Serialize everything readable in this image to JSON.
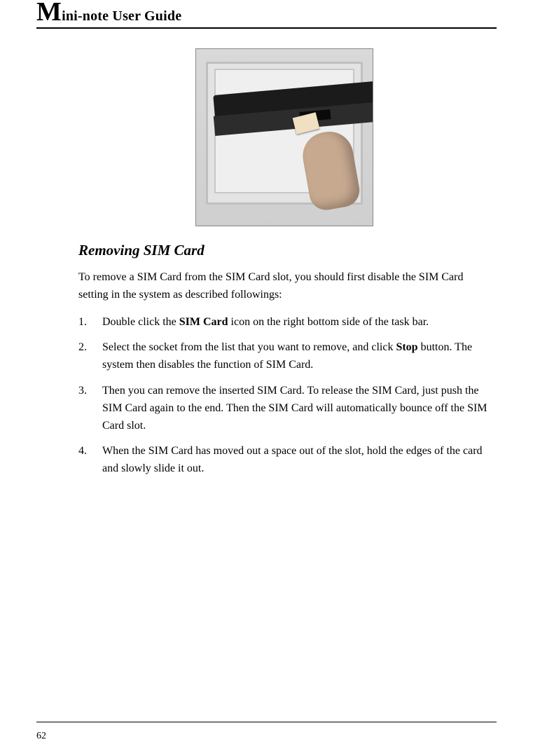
{
  "header": {
    "big_letter": "M",
    "rest": "ini-note User Guide"
  },
  "section": {
    "heading": "Removing SIM Card",
    "intro": "To remove a SIM Card from the SIM Card slot, you should first disable the SIM Card setting in the system as described followings:",
    "steps": [
      {
        "pre": "Double click the ",
        "bold": "SIM Card",
        "post": " icon on the right bottom side of the task bar."
      },
      {
        "pre": "Select the socket from the list that you want to remove, and click ",
        "bold": "Stop",
        "post": " button. The system then disables the function of SIM Card."
      },
      {
        "pre": "Then you can remove the inserted SIM Card. To release the SIM Card, just push the SIM Card again to the end. Then the SIM Card will automatically bounce off the SIM Card slot.",
        "bold": "",
        "post": ""
      },
      {
        "pre": "When the SIM Card has moved out a space out of the slot, hold the edges of the card and slowly slide it out.",
        "bold": "",
        "post": ""
      }
    ]
  },
  "page_number": "62"
}
